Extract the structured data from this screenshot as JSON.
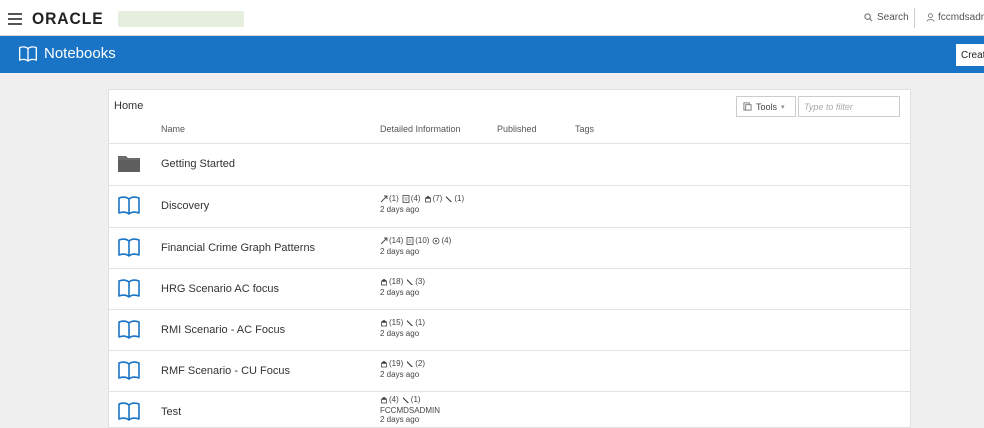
{
  "header": {
    "brand": "ORACLE",
    "search_label": "Search",
    "user_label": "fccmdsadmin"
  },
  "titlebar": {
    "title": "Notebooks",
    "create_label": "Create"
  },
  "panel": {
    "breadcrumb": "Home",
    "tools_label": "Tools",
    "filter_placeholder": "Type to filter",
    "columns": {
      "name": "Name",
      "detailed": "Detailed Information",
      "published": "Published",
      "tags": "Tags"
    },
    "rows": [
      {
        "name": "Getting Started",
        "type": "folder-icon",
        "stats": [],
        "owner": "",
        "updated": ""
      },
      {
        "name": "Discovery",
        "type": "notebook-icon",
        "stats": [
          {
            "icon": "link-icon",
            "count": "(1)"
          },
          {
            "icon": "document-icon",
            "count": "(4)"
          },
          {
            "icon": "paragraph-icon",
            "count": "(7)"
          },
          {
            "icon": "pen-icon",
            "count": "(1)"
          }
        ],
        "owner": "",
        "updated": "2 days ago"
      },
      {
        "name": "Financial Crime Graph Patterns",
        "type": "notebook-icon",
        "stats": [
          {
            "icon": "link-icon",
            "count": "(14)"
          },
          {
            "icon": "document-icon",
            "count": "(10)"
          },
          {
            "icon": "graph-icon",
            "count": "(4)"
          }
        ],
        "owner": "",
        "updated": "2 days ago"
      },
      {
        "name": "HRG Scenario   AC focus",
        "type": "notebook-icon",
        "stats": [
          {
            "icon": "paragraph-icon",
            "count": "(18)"
          },
          {
            "icon": "pen-icon",
            "count": "(3)"
          }
        ],
        "owner": "",
        "updated": "2 days ago"
      },
      {
        "name": "RMI  Scenario - AC Focus",
        "type": "notebook-icon",
        "stats": [
          {
            "icon": "paragraph-icon",
            "count": "(15)"
          },
          {
            "icon": "pen-icon",
            "count": "(1)"
          }
        ],
        "owner": "",
        "updated": "2 days ago"
      },
      {
        "name": "RMF Scenario - CU Focus",
        "type": "notebook-icon",
        "stats": [
          {
            "icon": "paragraph-icon",
            "count": "(19)"
          },
          {
            "icon": "pen-icon",
            "count": "(2)"
          }
        ],
        "owner": "",
        "updated": "2 days ago"
      },
      {
        "name": "Test",
        "type": "notebook-icon",
        "stats": [
          {
            "icon": "paragraph-icon",
            "count": "(4)"
          },
          {
            "icon": "pen-icon",
            "count": "(1)"
          }
        ],
        "owner": "FCCMDSADMIN",
        "updated": "2 days ago"
      }
    ]
  },
  "colors": {
    "header_blue": "#1a74c5",
    "folder_gray": "#6b6b6b",
    "notebook_blue": "#1a74c5"
  }
}
